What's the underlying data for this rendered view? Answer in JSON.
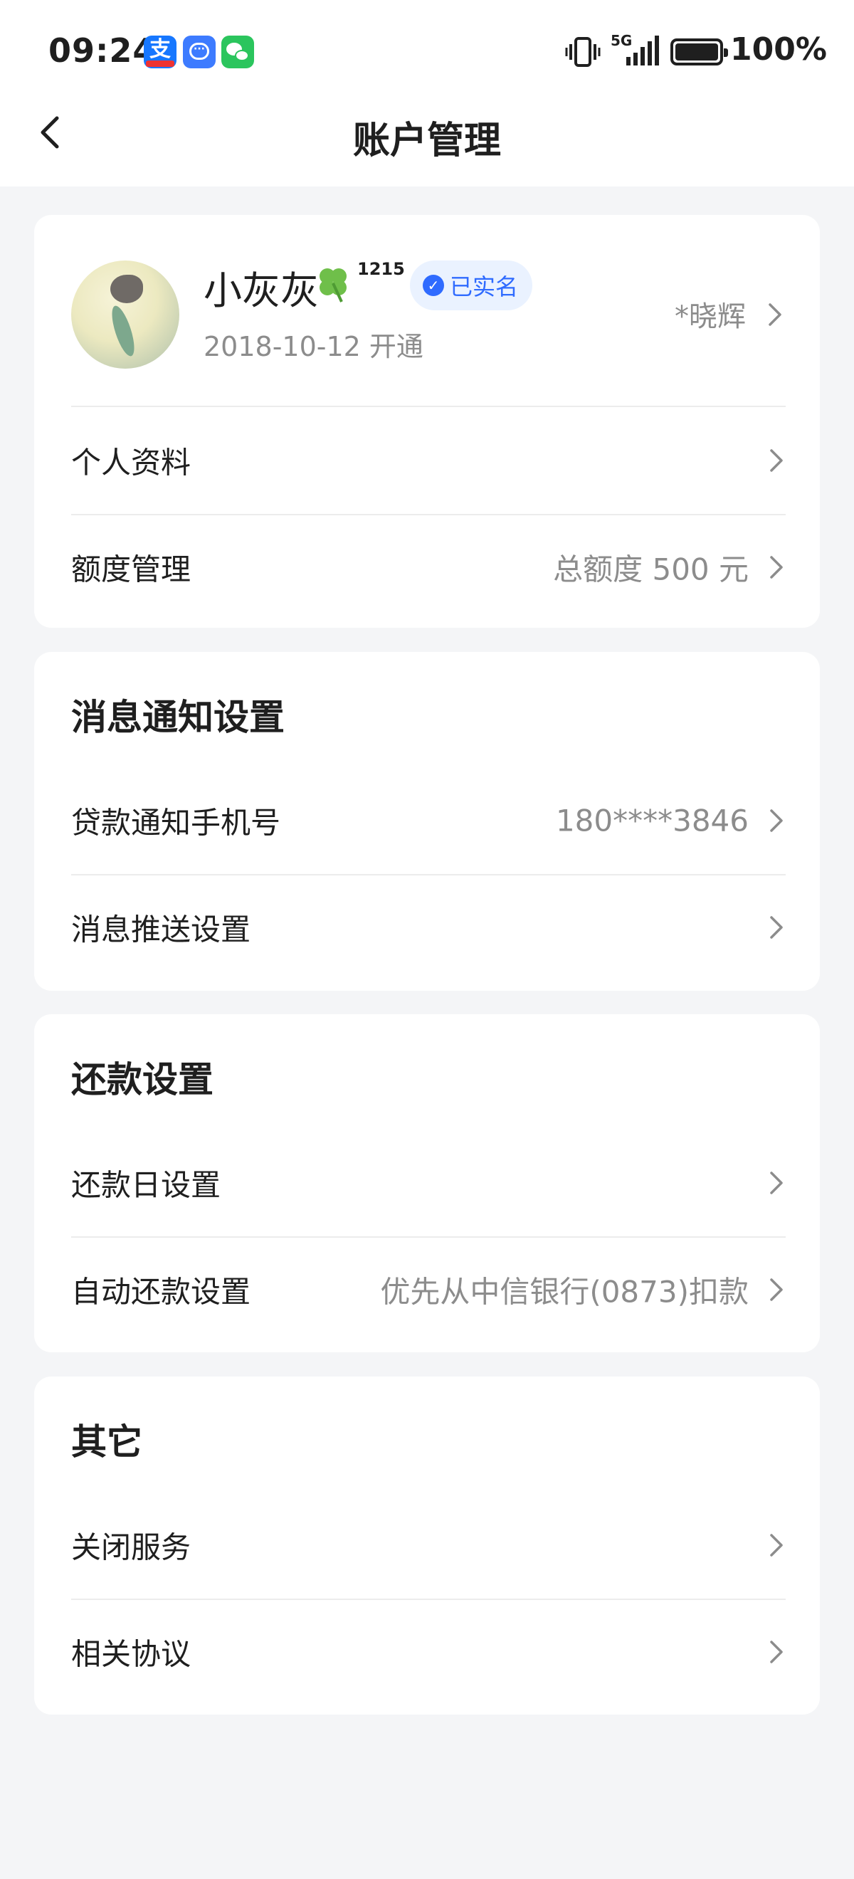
{
  "status_bar": {
    "time": "09:24",
    "network": "5G",
    "battery_text": "100%",
    "battery_level": 1.0,
    "apps": [
      "alipay-icon",
      "message-icon",
      "wechat-icon"
    ]
  },
  "nav": {
    "title": "账户管理",
    "back_icon": "chevron-left-icon"
  },
  "profile": {
    "name": "小灰灰",
    "name_suffix": "1215",
    "verified_label": "已实名",
    "open_date": "2018-10-12 开通",
    "masked_real_name": "*晓辉"
  },
  "account_items": [
    {
      "label": "个人资料",
      "value": ""
    },
    {
      "label": "额度管理",
      "value": "总额度 500 元"
    }
  ],
  "notification": {
    "title": "消息通知设置",
    "items": [
      {
        "label": "贷款通知手机号",
        "value": "180****3846"
      },
      {
        "label": "消息推送设置",
        "value": ""
      }
    ]
  },
  "repayment": {
    "title": "还款设置",
    "items": [
      {
        "label": "还款日设置",
        "value": ""
      },
      {
        "label": "自动还款设置",
        "value": "优先从中信银行(0873)扣款"
      }
    ]
  },
  "others": {
    "title": "其它",
    "items": [
      {
        "label": "关闭服务",
        "value": ""
      },
      {
        "label": "相关协议",
        "value": ""
      }
    ]
  },
  "colors": {
    "background": "#f4f5f7",
    "card": "#ffffff",
    "accent": "#2f6bff",
    "secondary_text": "#8c8c8c"
  }
}
